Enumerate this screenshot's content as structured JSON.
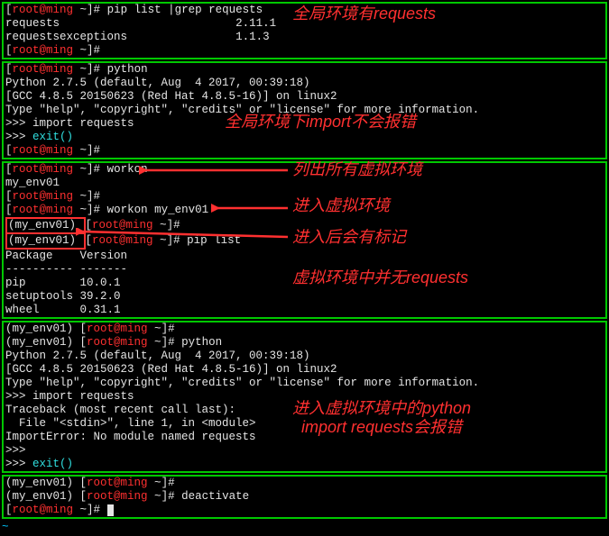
{
  "prompt": {
    "open": "[",
    "user": "root@ming",
    "path": " ~",
    "close": "]# "
  },
  "venv_prefix": "(my_env01) ",
  "block1": {
    "cmd": "pip list |grep requests",
    "row1_name": "requests",
    "row1_ver": "2.11.1",
    "row2_name": "requestsexceptions",
    "row2_ver": "1.1.3",
    "annot": "全局环境有requests"
  },
  "block2": {
    "cmd": "python",
    "v": "Python 2.7.5 (default, Aug  4 2017, 00:39:18)",
    "gcc": "[GCC 4.8.5 20150623 (Red Hat 4.8.5-16)] on linux2",
    "help": "Type \"help\", \"copyright\", \"credits\" or \"license\" for more information.",
    "imp": ">>> import requests",
    "exit": ">>> ",
    "exit_cmd": "exit()",
    "annot": "全局环境下import不会报错"
  },
  "block3": {
    "cmd_workon": "workon",
    "env_name": "my_env01",
    "cmd_workon_env": "workon my_env01",
    "cmd_piplist": "pip list",
    "hdr": "Package    Version",
    "dash": "---------- -------",
    "pip_row": "pip        10.0.1",
    "st_row": "setuptools 39.2.0",
    "wh_row": "wheel      0.31.1",
    "annot_list": "列出所有虚拟环境",
    "annot_enter": "进入虚拟环境",
    "annot_mark": "进入后会有标记",
    "annot_noreq": "虚拟环境中并无requests"
  },
  "block4": {
    "cmd": "python",
    "v": "Python 2.7.5 (default, Aug  4 2017, 00:39:18)",
    "gcc": "[GCC 4.8.5 20150623 (Red Hat 4.8.5-16)] on linux2",
    "help": "Type \"help\", \"copyright\", \"credits\" or \"license\" for more information.",
    "imp": ">>> import requests",
    "tb1": "Traceback (most recent call last):",
    "tb2": "  File \"<stdin>\", line 1, in <module>",
    "tb3": "ImportError: No module named requests",
    "ps": ">>>",
    "exit": ">>> ",
    "exit_cmd": "exit()",
    "annot1": "进入虚拟环境中的python",
    "annot2": "import requests会报错"
  },
  "block5": {
    "cmd": "deactivate"
  },
  "tilde": "~"
}
